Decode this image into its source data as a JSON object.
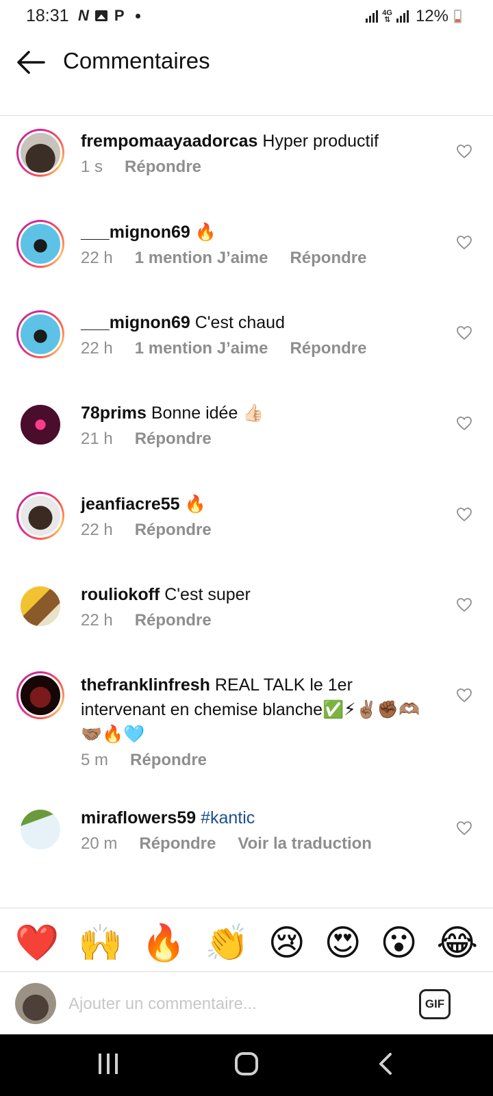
{
  "status_bar": {
    "time": "18:31",
    "net_label_top": "4G",
    "net_label_bottom": "⇅",
    "battery_pct": "12%",
    "battery_level": 0.12,
    "battery_color": "#e5673f"
  },
  "header": {
    "title": "Commentaires",
    "back_icon": "arrow-left-icon"
  },
  "comments": [
    {
      "username": "frempomaayaadorcas",
      "text": "Hyper productif",
      "time": "1 s",
      "likes": "",
      "reply": "Répondre",
      "extra": "",
      "hashtag": ""
    },
    {
      "username": "___mignon69",
      "text": "🔥",
      "time": "22 h",
      "likes": "1 mention J’aime",
      "reply": "Répondre",
      "extra": "",
      "hashtag": ""
    },
    {
      "username": "___mignon69",
      "text": "C'est chaud",
      "time": "22 h",
      "likes": "1 mention J’aime",
      "reply": "Répondre",
      "extra": "",
      "hashtag": ""
    },
    {
      "username": "78prims",
      "text": "Bonne idée 👍🏻",
      "time": "21 h",
      "likes": "",
      "reply": "Répondre",
      "extra": "",
      "hashtag": ""
    },
    {
      "username": "jeanfiacre55",
      "text": "🔥",
      "time": "22 h",
      "likes": "",
      "reply": "Répondre",
      "extra": "",
      "hashtag": ""
    },
    {
      "username": "rouliokoff",
      "text": "C'est super",
      "time": "22 h",
      "likes": "",
      "reply": "Répondre",
      "extra": "",
      "hashtag": ""
    },
    {
      "username": "thefranklinfresh",
      "text": "REAL TALK le 1er intervenant en chemise blanche✅⚡✌🏽✊🏾🫶🏽🤝🏽🔥🩵",
      "time": "5 m",
      "likes": "",
      "reply": "Répondre",
      "extra": "",
      "hashtag": ""
    },
    {
      "username": "miraflowers59",
      "text": "",
      "time": "20 m",
      "likes": "",
      "reply": "Répondre",
      "extra": "Voir la traduction",
      "hashtag": "#kantic"
    }
  ],
  "emoji_reactions": [
    "❤️",
    "🙌",
    "🔥",
    "👏",
    "😢",
    "😍",
    "😮",
    "😂"
  ],
  "composer": {
    "placeholder": "Ajouter un commentaire...",
    "gif_label": "GIF"
  },
  "nav_bar": {
    "recents_icon": "recent-apps-icon",
    "home_icon": "home-icon",
    "back_icon": "back-icon"
  },
  "colors": {
    "hashtag": "#1d4f8c",
    "meta_gray": "#8e8e8e",
    "story_ring_start": "#d6249f",
    "story_ring_end": "#fdc468"
  }
}
